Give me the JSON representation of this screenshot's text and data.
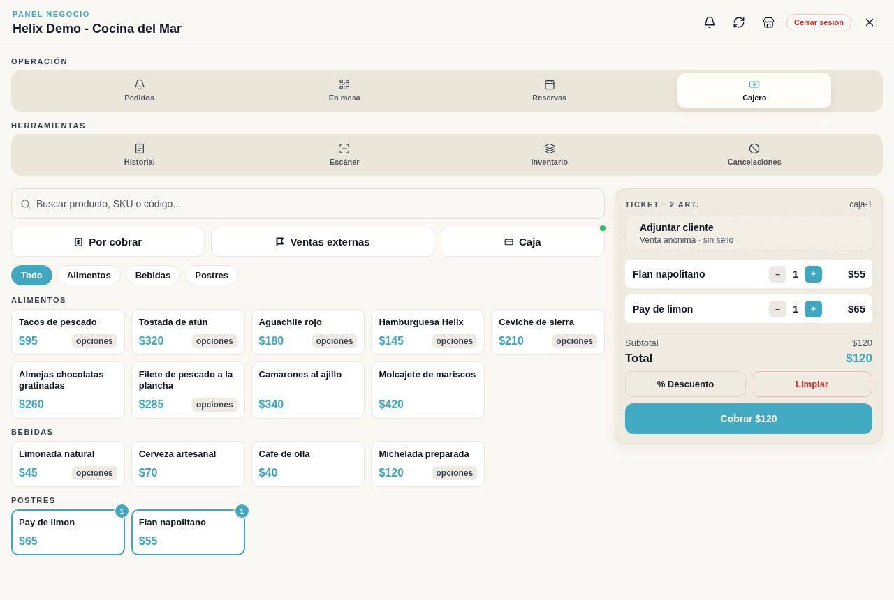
{
  "header": {
    "eyebrow": "PANEL NEGOCIO",
    "title": "Helix Demo - Cocina del Mar",
    "logout_button": "Cerrar sesión"
  },
  "nav_groups": [
    {
      "label": "OPERACIÓN",
      "tabs": [
        {
          "label": "Pedidos",
          "selected": false
        },
        {
          "label": "En mesa",
          "selected": false
        },
        {
          "label": "Reservas",
          "selected": false
        },
        {
          "label": "Cajero",
          "selected": true
        }
      ]
    },
    {
      "label": "HERRAMIENTAS",
      "tabs": [
        {
          "label": "Historial",
          "selected": false
        },
        {
          "label": "Escáner",
          "selected": false
        },
        {
          "label": "Inventario",
          "selected": false
        },
        {
          "label": "Cancelaciones",
          "selected": false
        }
      ]
    }
  ],
  "search": {
    "placeholder": "Buscar producto, SKU o código..."
  },
  "quick_actions": [
    {
      "label": "Por cobrar",
      "indicator": false
    },
    {
      "label": "Ventas externas",
      "indicator": false
    },
    {
      "label": "Caja",
      "indicator": true
    }
  ],
  "filters": [
    {
      "label": "Todo",
      "selected": true
    },
    {
      "label": "Alimentos",
      "selected": false
    },
    {
      "label": "Bebidas",
      "selected": false
    },
    {
      "label": "Postres",
      "selected": false
    }
  ],
  "catalog": [
    {
      "title": "ALIMENTOS",
      "products": [
        {
          "name": "Tacos de pescado",
          "price": "$95",
          "options": "opciones",
          "selected": false
        },
        {
          "name": "Tostada de atún",
          "price": "$320",
          "options": "opciones",
          "selected": false
        },
        {
          "name": "Aguachile rojo",
          "price": "$180",
          "options": "opciones",
          "selected": false
        },
        {
          "name": "Hamburguesa Helix",
          "price": "$145",
          "options": "opciones",
          "selected": false
        },
        {
          "name": "Ceviche de sierra",
          "price": "$210",
          "options": "opciones",
          "selected": false
        },
        {
          "name": "Almejas chocolatas gratinadas",
          "price": "$260",
          "selected": false
        },
        {
          "name": "Filete de pescado a la plancha",
          "price": "$285",
          "options": "opciones",
          "selected": false
        },
        {
          "name": "Camarones al ajillo",
          "price": "$340",
          "selected": false
        },
        {
          "name": "Molcajete de mariscos",
          "price": "$420",
          "selected": false
        }
      ]
    },
    {
      "title": "BEBIDAS",
      "products": [
        {
          "name": "Limonada natural",
          "price": "$45",
          "options": "opciones",
          "selected": false
        },
        {
          "name": "Cerveza artesanal",
          "price": "$70",
          "selected": false
        },
        {
          "name": "Cafe de olla",
          "price": "$40",
          "selected": false
        },
        {
          "name": "Michelada preparada",
          "price": "$120",
          "options": "opciones",
          "selected": false
        }
      ]
    },
    {
      "title": "POSTRES",
      "products": [
        {
          "name": "Pay de limon",
          "price": "$65",
          "selected": true,
          "badge": "1"
        },
        {
          "name": "Flan napolitano",
          "price": "$55",
          "selected": true,
          "badge": "1"
        }
      ]
    }
  ],
  "ticket": {
    "title": "TICKET · 2 ART.",
    "register": "caja-1",
    "customer": {
      "title": "Adjuntar cliente",
      "subtitle": "Venta anónima · sin sello"
    },
    "items": [
      {
        "name": "Flan napolitano",
        "decrement": "–",
        "quantity": "1",
        "increment": "+",
        "price": "$55"
      },
      {
        "name": "Pay de limon",
        "decrement": "–",
        "quantity": "1",
        "increment": "+",
        "price": "$65"
      }
    ],
    "subtotal": {
      "label": "Subtotal",
      "value": "$120"
    },
    "total": {
      "label": "Total",
      "value": "$120"
    },
    "discount_button": "% Descuento",
    "clear_button": "Limpiar",
    "charge_button": "Cobrar $120"
  }
}
